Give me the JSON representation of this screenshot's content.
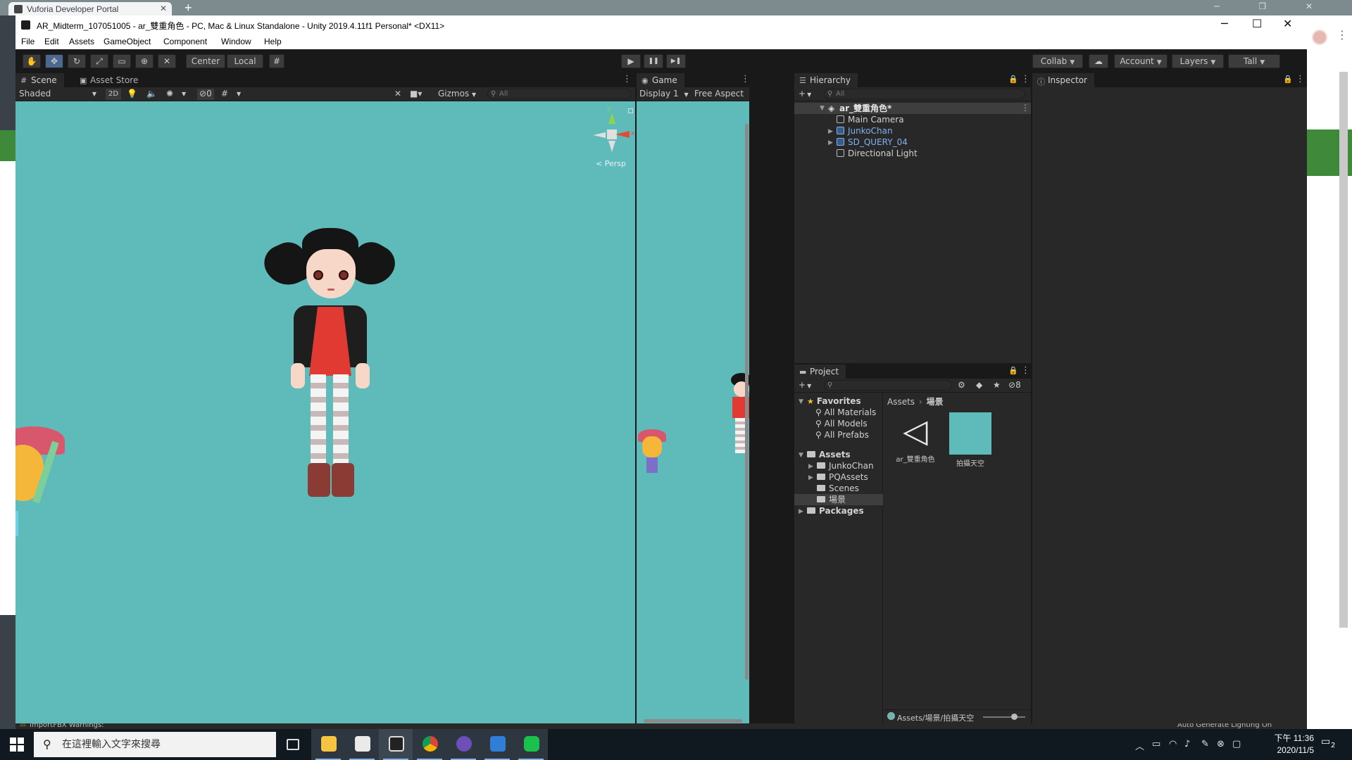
{
  "browser": {
    "tab_title": "Vuforia Developer Portal",
    "close_glyph": "✕",
    "new_tab_glyph": "+",
    "window_controls": "─ ❐ ✕"
  },
  "window": {
    "title": "AR_Midterm_107051005 - ar_雙重角色 - PC, Mac & Linux Standalone - Unity 2019.4.11f1 Personal* <DX11>",
    "minimize": "─",
    "maximize": "☐",
    "close": "✕"
  },
  "menu": [
    "File",
    "Edit",
    "Assets",
    "GameObject",
    "Component",
    "Window",
    "Help"
  ],
  "toolbar": {
    "tools": [
      "hand-tool",
      "move-tool",
      "rotate-tool",
      "scale-tool",
      "rect-tool",
      "transform-tool",
      "custom-tool"
    ],
    "pivot_label": "Center",
    "space_label": "Local",
    "play": "▶",
    "pause": "❚❚",
    "step": "▶❚",
    "collab_label": "Collab",
    "account_label": "Account",
    "layers_label": "Layers",
    "layout_label": "Tall"
  },
  "scene": {
    "tab_label": "Scene",
    "asset_store_label": "Asset Store",
    "shading_mode": "Shaded",
    "mode_2d": "2D",
    "hidden_count": "0",
    "gizmos_label": "Gizmos",
    "search_placeholder": "All",
    "persp_label": "< Persp",
    "gizmo_axes": {
      "y": "y",
      "x": "x"
    }
  },
  "game": {
    "tab_label": "Game",
    "display": "Display 1",
    "aspect": "Free Aspect"
  },
  "hierarchy": {
    "tab_label": "Hierarchy",
    "search_placeholder": "All",
    "scene_name": "ar_雙重角色*",
    "items": [
      {
        "label": "Main Camera",
        "prefab": false,
        "expandable": false
      },
      {
        "label": "JunkoChan",
        "prefab": true,
        "expandable": true
      },
      {
        "label": "SD_QUERY_04",
        "prefab": true,
        "expandable": true
      },
      {
        "label": "Directional Light",
        "prefab": false,
        "expandable": false
      }
    ]
  },
  "inspector": {
    "tab_label": "Inspector"
  },
  "project": {
    "tab_label": "Project",
    "hidden_count": "8",
    "favorites_label": "Favorites",
    "favorites": [
      "All Materials",
      "All Models",
      "All Prefabs"
    ],
    "assets_label": "Assets",
    "asset_folders": [
      {
        "label": "JunkoChan",
        "expandable": true,
        "selected": false
      },
      {
        "label": "PQAssets",
        "expandable": true,
        "selected": false
      },
      {
        "label": "Scenes",
        "expandable": false,
        "selected": false
      },
      {
        "label": "場景",
        "expandable": false,
        "selected": true
      }
    ],
    "packages_label": "Packages",
    "breadcrumb": [
      "Assets",
      "場景"
    ],
    "files": [
      {
        "label": "ar_雙重角色",
        "icon": "unity-scene-icon"
      },
      {
        "label": "拍攝天空",
        "icon": "material-swatch-icon",
        "color": "#5ebbb9"
      }
    ],
    "status_path": "Assets/場景/拍攝天空"
  },
  "statusbar": {
    "left_text": "ImportFBX Warnings:",
    "right_text": "Auto Generate Lighting On"
  },
  "taskbar": {
    "search_placeholder": "在這裡輸入文字來搜尋",
    "apps": [
      "task-view-icon",
      "file-explorer-icon",
      "unity-hub-icon",
      "unity-editor-icon",
      "chrome-icon",
      "discord-like-icon",
      "media-icon",
      "line-icon"
    ],
    "time": "下午 11:36",
    "date": "2020/11/5",
    "notification_count": "2"
  },
  "colors": {
    "sky": "#5ebbb9",
    "panel": "#282828",
    "editor_bg": "#191919",
    "prefab_blue": "#7fb2f0"
  }
}
